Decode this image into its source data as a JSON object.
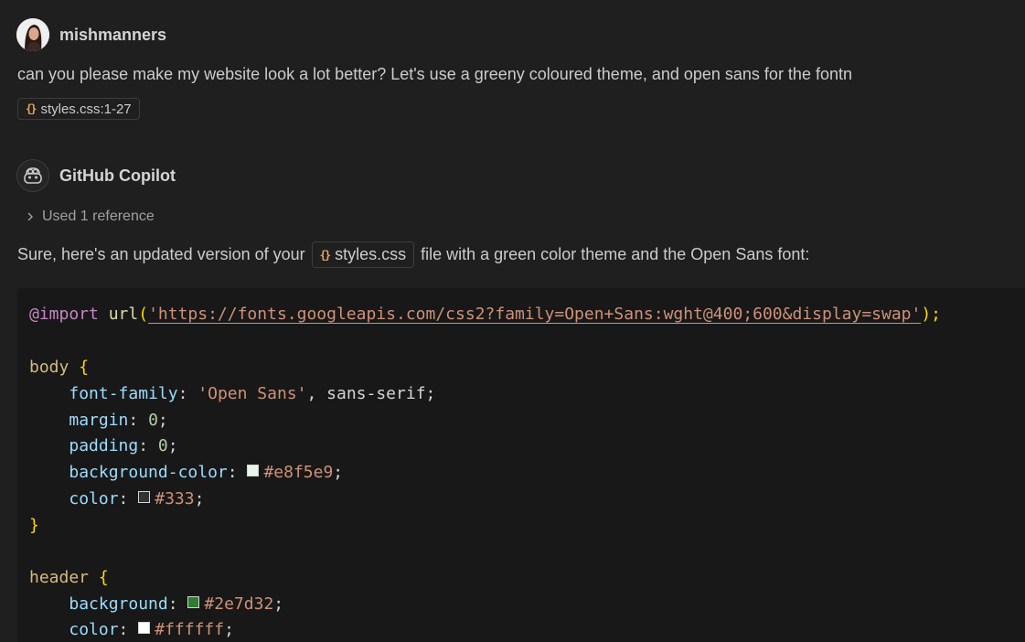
{
  "user_message": {
    "username": "mishmanners",
    "avatar_icon": "user-avatar",
    "text": "can you please make my website look a lot better? Let's use a greeny coloured theme, and open sans for the fontn",
    "attachment_label": "styles.css:1-27"
  },
  "assistant_message": {
    "username": "GitHub Copilot",
    "avatar_icon": "copilot-icon",
    "references_label": "Used 1 reference",
    "text_before": "Sure, here's an updated version of your",
    "file_chip": "styles.css",
    "text_after": "file with a green color theme and the Open Sans font:"
  },
  "code": {
    "language": "css",
    "line1": {
      "at": "@import",
      "fn": "url",
      "open": "(",
      "url": "'https://fonts.googleapis.com/css2?family=Open+Sans:wght@400;600&display=swap'",
      "close": ");"
    },
    "body": {
      "selector": "body",
      "open": "{",
      "close": "}",
      "font_family_prop": "font-family",
      "font_family_str": "'Open Sans'",
      "font_family_rest": ", sans-serif;",
      "margin_prop": "margin",
      "margin_val": "0",
      "padding_prop": "padding",
      "padding_val": "0",
      "bg_prop": "background-color",
      "bg_val": "#e8f5e9",
      "color_prop": "color",
      "color_val": "#333"
    },
    "header": {
      "selector": "header",
      "open": "{",
      "bg_prop": "background",
      "bg_val": "#2e7d32",
      "color_prop": "color",
      "color_val": "#ffffff"
    }
  },
  "colors": {
    "swatch_e8f5e9": "#e8f5e9",
    "swatch_333": "#333333",
    "swatch_2e7d32": "#2e7d32",
    "swatch_ffffff": "#ffffff"
  }
}
